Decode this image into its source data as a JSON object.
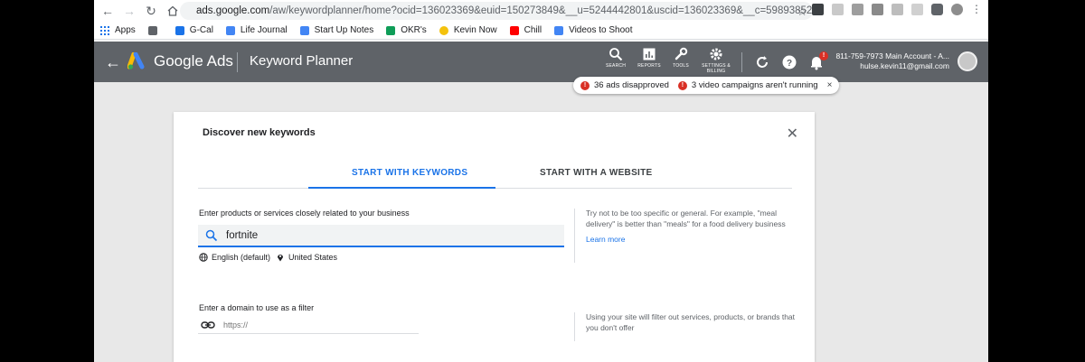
{
  "browser": {
    "url_host": "ads.google.com",
    "url_path": "/aw/keywordplanner/home?ocid=136023369&euid=150273849&__u=5244442801&uscid=136023369&__c=5989385281...",
    "bookmarks": [
      {
        "label": "Apps"
      },
      {
        "label": ""
      },
      {
        "label": "G-Cal"
      },
      {
        "label": "Life Journal"
      },
      {
        "label": "Start Up Notes"
      },
      {
        "label": "OKR's"
      },
      {
        "label": "Kevin Now"
      },
      {
        "label": "Chill"
      },
      {
        "label": "Videos to Shoot"
      }
    ]
  },
  "header": {
    "brand": "Google Ads",
    "page_title": "Keyword Planner",
    "tools": [
      {
        "label": "SEARCH"
      },
      {
        "label": "REPORTS"
      },
      {
        "label": "TOOLS"
      },
      {
        "label": "SETTINGS & BILLING"
      }
    ],
    "account_line1": "811-759-7973 Main Account - A...",
    "account_line2": "hulse.kevin11@gmail.com",
    "notification_badge": "!"
  },
  "notices": {
    "ads_disapproved": "36 ads disapproved",
    "campaigns_not_running": "3 video campaigns aren't running",
    "close": "×"
  },
  "dialog": {
    "title": "Discover new keywords",
    "tabs": [
      {
        "label": "START WITH KEYWORDS",
        "active": true
      },
      {
        "label": "START WITH A WEBSITE",
        "active": false
      }
    ],
    "keywords_label": "Enter products or services closely related to your business",
    "keywords_value": "fortnite",
    "language": "English (default)",
    "location": "United States",
    "keywords_hint": "Try not to be too specific or general. For example, \"meal delivery\" is better than \"meals\" for a food delivery business",
    "learn_more": "Learn more",
    "domain_label": "Enter a domain to use as a filter",
    "domain_placeholder": "https://",
    "domain_hint": "Using your site will filter out services, products, or brands that you don't offer"
  },
  "colors": {
    "accent": "#1a73e8",
    "header_bg": "#5f6368",
    "alert": "#d93025"
  }
}
